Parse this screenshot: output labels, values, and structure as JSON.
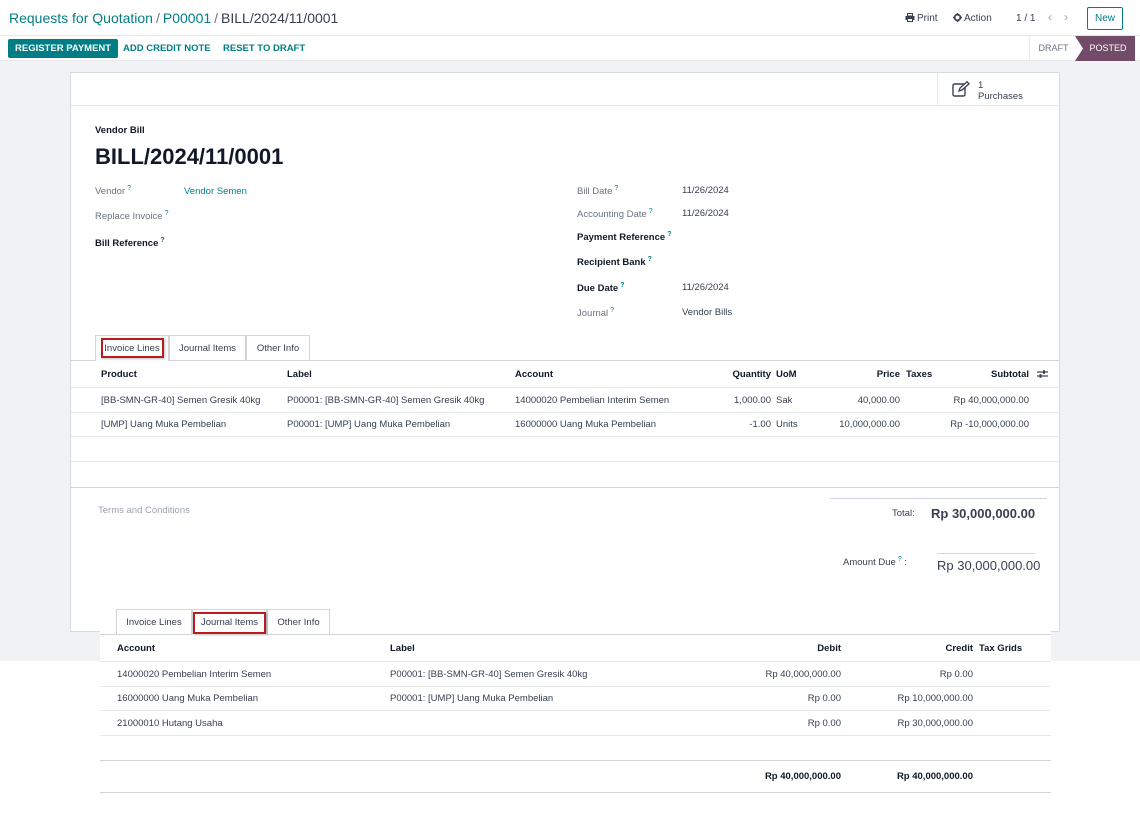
{
  "breadcrumb": {
    "items": [
      "Requests for Quotation",
      "P00001",
      "BILL/2024/11/0001"
    ],
    "separator": "/"
  },
  "toolbar": {
    "print": "Print",
    "action": "Action",
    "pager": "1 / 1",
    "new": "New"
  },
  "actions": {
    "register_payment": "REGISTER PAYMENT",
    "add_credit_note": "ADD CREDIT NOTE",
    "reset_to_draft": "RESET TO DRAFT"
  },
  "status": {
    "draft": "DRAFT",
    "posted": "POSTED",
    "current": "POSTED"
  },
  "smart_button": {
    "count": "1",
    "label": "Purchases"
  },
  "bill": {
    "type": "Vendor Bill",
    "number": "BILL/2024/11/0001",
    "left_fields": [
      {
        "label": "Vendor",
        "value": "Vendor Semen",
        "bold": false
      },
      {
        "label": "Replace Invoice",
        "value": "",
        "bold": false
      },
      {
        "label": "Bill Reference",
        "value": "",
        "bold": true
      }
    ],
    "right_fields": [
      {
        "label": "Bill Date",
        "value": "11/26/2024",
        "bold": false
      },
      {
        "label": "Accounting Date",
        "value": "11/26/2024",
        "bold": false
      },
      {
        "label": "Payment Reference",
        "value": "",
        "bold": true
      },
      {
        "label": "Recipient Bank",
        "value": "",
        "bold": true
      },
      {
        "label": "Due Date",
        "value": "11/26/2024",
        "bold": true
      },
      {
        "label": "Journal",
        "value": "Vendor Bills",
        "bold": false
      }
    ],
    "help_mark": "?"
  },
  "tabs": [
    "Invoice Lines",
    "Journal Items",
    "Other Info"
  ],
  "invoice_lines": {
    "headers": [
      "Product",
      "Label",
      "Account",
      "Quantity",
      "UoM",
      "Price",
      "Taxes",
      "Subtotal"
    ],
    "rows": [
      [
        "[BB-SMN-GR-40] Semen Gresik 40kg",
        "P00001: [BB-SMN-GR-40] Semen Gresik 40kg",
        "14000020 Pembelian Interim Semen",
        "1,000.00",
        "Sak",
        "40,000.00",
        "",
        "Rp 40,000,000.00"
      ],
      [
        "[UMP] Uang Muka Pembelian",
        "P00001: [UMP] Uang Muka Pembelian",
        "16000000 Uang Muka Pembelian",
        "-1.00",
        "Units",
        "10,000,000.00",
        "",
        "Rp -10,000,000.00"
      ]
    ]
  },
  "totals": {
    "terms_placeholder": "Terms and Conditions",
    "total_label": "Total:",
    "total_value": "Rp 30,000,000.00",
    "amount_due_label": "Amount Due",
    "amount_due_value": "Rp 30,000,000.00"
  },
  "journal_items": {
    "headers": [
      "Account",
      "Label",
      "Debit",
      "Credit",
      "Tax Grids"
    ],
    "rows": [
      [
        "14000020 Pembelian Interim Semen",
        "P00001: [BB-SMN-GR-40] Semen Gresik 40kg",
        "Rp 40,000,000.00",
        "Rp 0.00",
        ""
      ],
      [
        "16000000 Uang Muka Pembelian",
        "P00001: [UMP] Uang Muka Pembelian",
        "Rp 0.00",
        "Rp 10,000,000.00",
        ""
      ],
      [
        "21000010 Hutang Usaha",
        "",
        "Rp 0.00",
        "Rp 30,000,000.00",
        ""
      ]
    ],
    "footer": {
      "debit": "Rp 40,000,000.00",
      "credit": "Rp 40,000,000.00"
    }
  },
  "colors": {
    "primary": "#017e84",
    "posted": "#714b67",
    "highlight": "#b91c1c"
  },
  "icons": [
    "print-icon",
    "gear-icon",
    "chevron-left-icon",
    "chevron-right-icon",
    "edit-icon",
    "column-settings-icon"
  ]
}
